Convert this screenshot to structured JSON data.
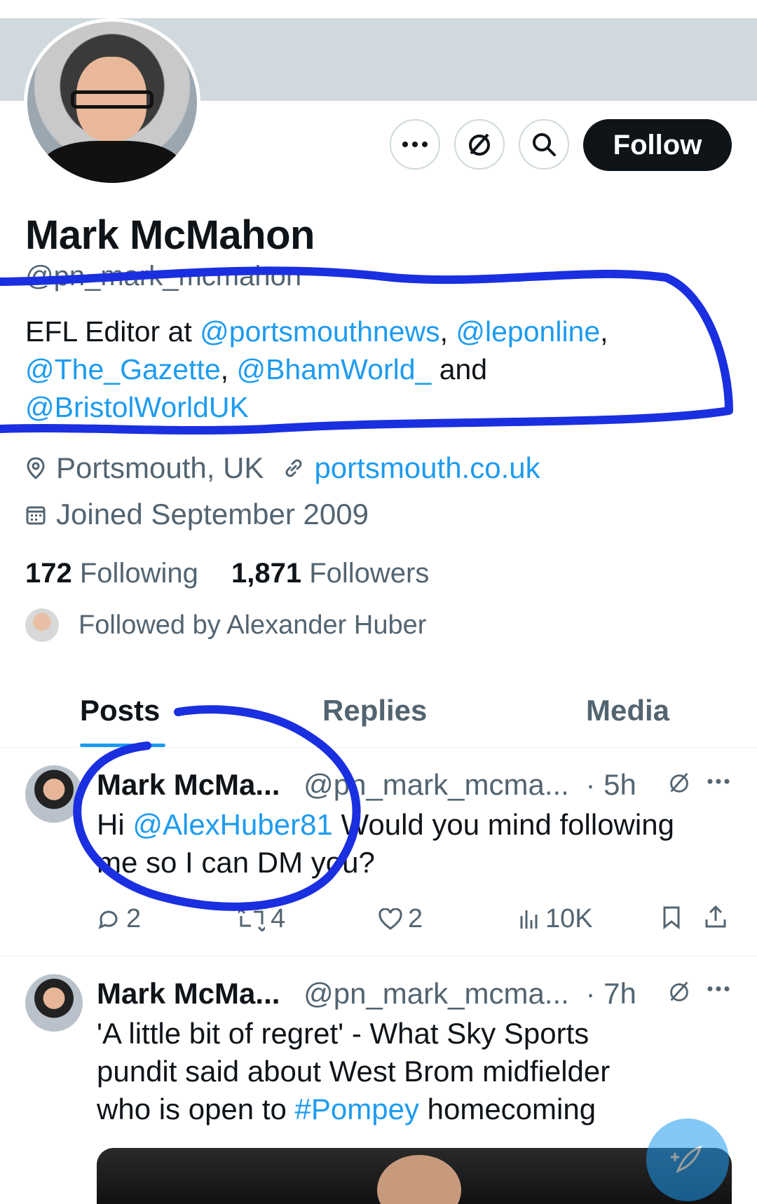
{
  "profile": {
    "name": "Mark McMahon",
    "handle": "@pn_mark_mcmahon",
    "bio_prefix": "EFL Editor at ",
    "bio_mentions": [
      "@portsmouthnews",
      "@leponline",
      "@The_Gazette",
      "@BhamWorld_",
      "@BristolWorldUK"
    ],
    "bio_sep1": ", ",
    "bio_sep2": ",",
    "bio_sep3": ", ",
    "bio_and": " and",
    "location": "Portsmouth, UK",
    "website": "portsmouth.co.uk",
    "joined": "Joined September 2009",
    "following_count": "172",
    "following_label": "Following",
    "followers_count": "1,871",
    "followers_label": "Followers",
    "followed_by": "Followed by Alexander Huber"
  },
  "header_actions": {
    "follow_label": "Follow",
    "more_icon": "more-icon",
    "subscribe_icon": "subscribe-icon",
    "search_icon": "search-icon"
  },
  "tabs": [
    {
      "label": "Posts",
      "active": true
    },
    {
      "label": "Replies",
      "active": false
    },
    {
      "label": "Media",
      "active": false
    }
  ],
  "posts": [
    {
      "name": "Mark McMa...",
      "handle": "@pn_mark_mcma...",
      "time": "· 5h",
      "text_prefix": "Hi ",
      "mention": "@AlexHuber81",
      "text_line1_rest": " Would you mind following",
      "text_line2": "me so I can DM you?",
      "replies": "2",
      "reposts": "4",
      "likes": "2",
      "views": "10K"
    },
    {
      "name": "Mark McMa...",
      "handle": "@pn_mark_mcma...",
      "time": "· 7h",
      "text_line1": "'A little bit of regret' - What Sky Sports",
      "text_line2": "pundit said about West Brom midfielder",
      "text_line3_prefix": "who is open to ",
      "hashtag": "#Pompey",
      "text_line3_suffix": " homecoming"
    }
  ],
  "colors": {
    "accent": "#1d9bf0",
    "text": "#0f1419",
    "secondary": "#536471",
    "banner": "#cfd9de",
    "annotation": "#1a2fe0"
  }
}
